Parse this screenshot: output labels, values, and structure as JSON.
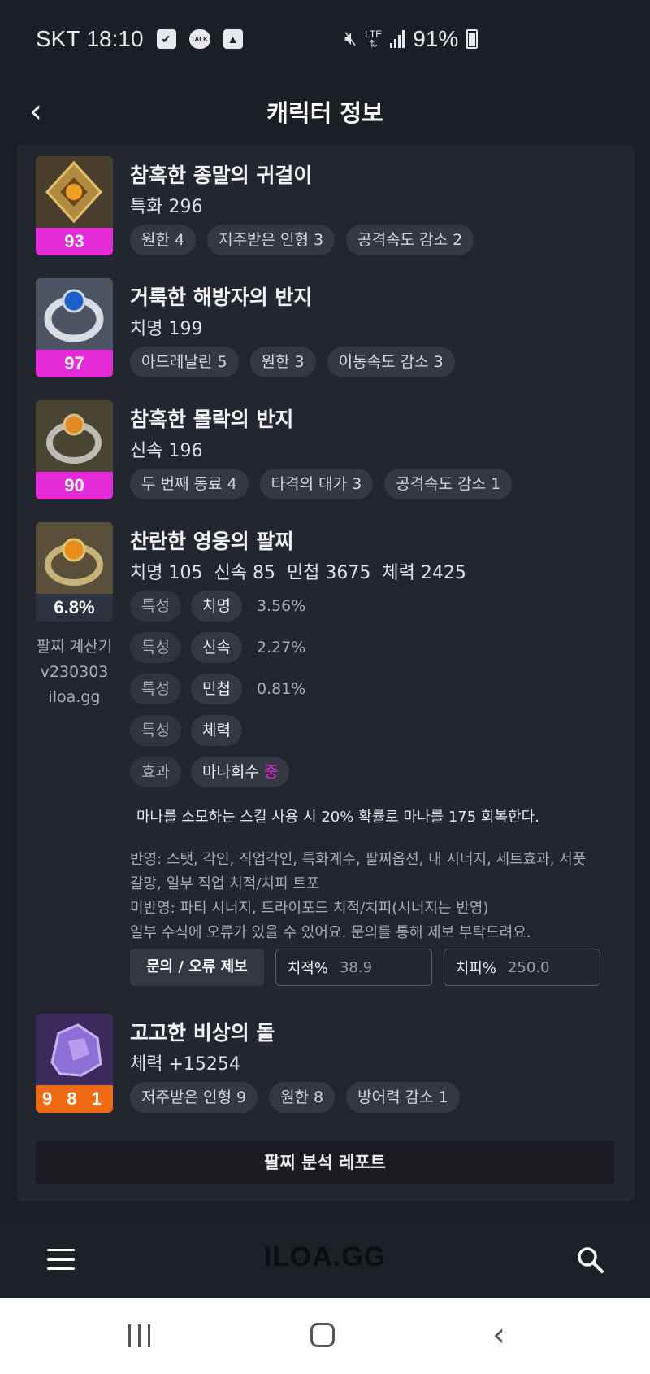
{
  "status": {
    "carrier": "SKT",
    "time": "18:10",
    "network": "LTE",
    "battery": "91%"
  },
  "header": {
    "title": "캐릭터 정보"
  },
  "items": [
    {
      "name": "참혹한 종말의 귀걸이",
      "stat": "특화 296",
      "level": "93",
      "tags": [
        "원한 4",
        "저주받은 인형 3",
        "공격속도 감소 2"
      ]
    },
    {
      "name": "거룩한 해방자의 반지",
      "stat": "치명 199",
      "level": "97",
      "tags": [
        "아드레날린 5",
        "원한 3",
        "이동속도 감소 3"
      ]
    },
    {
      "name": "참혹한 몰락의 반지",
      "stat": "신속 196",
      "level": "90",
      "tags": [
        "두 번째 동료 4",
        "타격의 대가 3",
        "공격속도 감소 1"
      ]
    }
  ],
  "bracelet": {
    "name": "찬란한 영웅의 팔찌",
    "stats": [
      "치명 105",
      "신속 85",
      "민첩 3675",
      "체력 2425"
    ],
    "percent": "6.8%",
    "side_note": [
      "팔찌 계산기",
      "v230303",
      "iloa.gg"
    ],
    "traits": [
      {
        "label": "특성",
        "value": "치명",
        "pct": "3.56%"
      },
      {
        "label": "특성",
        "value": "신속",
        "pct": "2.27%"
      },
      {
        "label": "특성",
        "value": "민첩",
        "pct": "0.81%"
      },
      {
        "label": "특성",
        "value": "체력",
        "pct": ""
      }
    ],
    "effect": {
      "label": "효과",
      "value": "마나회수",
      "grade": "중"
    },
    "effect_desc": "마나를 소모하는 스킬 사용 시 20% 확률로 마나를 175 회복한다.",
    "notes": [
      "반영: 스탯, 각인, 직업각인, 특화계수, 팔찌옵션, 내 시너지, 세트효과, 서풋",
      "갈망, 일부 직업 치적/치피 트포",
      "미반영: 파티 시너지, 트라이포드 치적/치피(시너지는 반영)",
      "일부 수식에 오류가 있을 수 있어요. 문의를 통해 제보 부탁드려요."
    ],
    "report_button": "문의 / 오류 제보",
    "crit_rate": {
      "label": "치적%",
      "value": "38.9"
    },
    "crit_dmg": {
      "label": "치피%",
      "value": "250.0"
    }
  },
  "stone": {
    "name": "고고한 비상의 돌",
    "stat": "체력 +15254",
    "level": "9 8 1",
    "tags": [
      "저주받은 인형 9",
      "원한 8",
      "방어력 감소 1"
    ]
  },
  "analysis_button": "팔찌 분석 레포트",
  "bottom": {
    "logo": "ILOA.GG"
  },
  "colors": {
    "accent_magenta": "#e52ad7",
    "accent_orange": "#ef6a12",
    "background": "#1b1e25",
    "card": "#23262e"
  }
}
